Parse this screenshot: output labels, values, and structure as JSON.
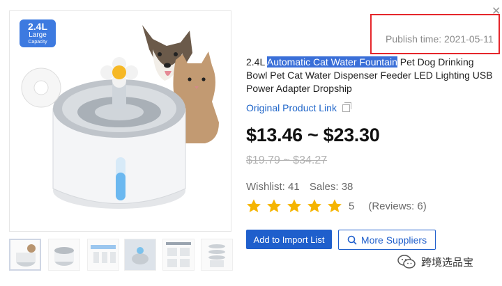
{
  "product": {
    "badge_size": "2.4L",
    "badge_line1": "Large",
    "badge_line2": "Capacity",
    "publish_time": "Publish time: 2021-05-11",
    "title_before": "2.4L ",
    "title_highlight": "Automatic Cat Water Fountain",
    "title_after": " Pet Dog Drinking Bowl Pet Cat Water Dispenser Feeder LED Lighting USB Power Adapter Dropship",
    "original_link": "Original Product Link",
    "price": "$13.46 ~ $23.30",
    "old_price": "$19.79 ~ $34.27",
    "wishlist": "Wishlist: 41",
    "sales": "Sales: 38",
    "rating_value": "5",
    "stars": 5,
    "reviews": "(Reviews: 6)"
  },
  "actions": {
    "import_label": "Add to Import List",
    "suppliers_label": "More Suppliers"
  },
  "thumbnails": [
    "thumb-1",
    "thumb-2",
    "thumb-3",
    "thumb-4",
    "thumb-5",
    "thumb-6"
  ],
  "watermark": {
    "text": "跨境选品宝"
  },
  "colors": {
    "accent": "#1f5fcc",
    "highlight": "#3a6fd8",
    "star": "#f5b400",
    "annotation_border": "#e5262b"
  },
  "icons": [
    "close-icon",
    "copy-icon",
    "search-icon",
    "star-icon",
    "wechat-icon"
  ]
}
